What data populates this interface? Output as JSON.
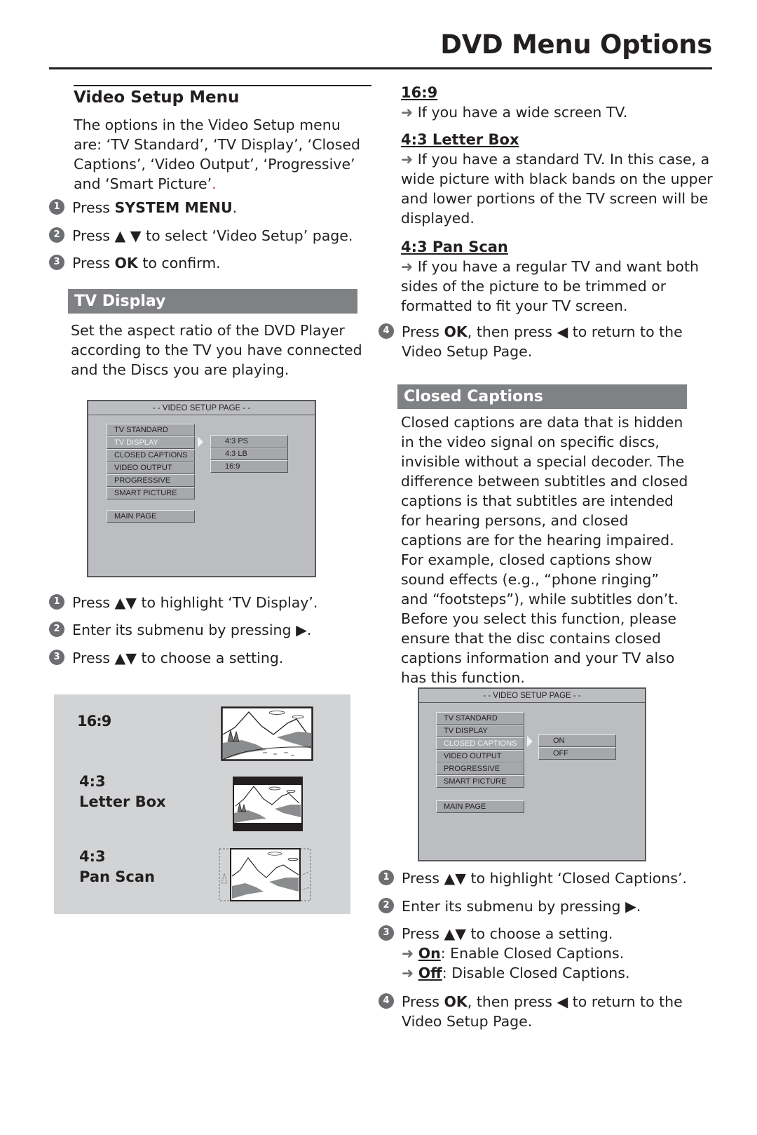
{
  "page": {
    "title": "DVD Menu Options"
  },
  "video_setup": {
    "heading": "Video Setup Menu",
    "intro": "The options in the Video Setup menu are: ‘TV Standard’, ‘TV Display’, ‘Closed Captions’, ‘Video Output’, ‘Progressive’ and ‘Smart Picture’",
    "intro_end": ".",
    "steps": [
      {
        "num": "1",
        "pre": "Press ",
        "bold": "SYSTEM MENU",
        "post": "."
      },
      {
        "num": "2",
        "pre": "Press ▲ ▼ to select ‘Video Setup’ page.",
        "bold": "",
        "post": ""
      },
      {
        "num": "3",
        "pre": "Press ",
        "bold": "OK",
        "post": " to confirm."
      }
    ]
  },
  "tv_display": {
    "heading": "TV Display",
    "description": "Set the aspect ratio of the DVD Player according to the TV you have connected and the Discs you are playing.",
    "osd": {
      "header": "- - VIDEO SETUP PAGE - -",
      "items": [
        "TV STANDARD",
        "TV DISPLAY",
        "CLOSED CAPTIONS",
        "VIDEO OUTPUT",
        "PROGRESSIVE",
        "SMART PICTURE"
      ],
      "selected_index": 1,
      "main_page": "MAIN PAGE",
      "submenu": [
        "4:3 PS",
        "4:3 LB",
        "16:9"
      ]
    },
    "steps": [
      {
        "num": "1",
        "text": "Press ▲▼ to highlight ‘TV Display’."
      },
      {
        "num": "2",
        "text": "Enter its submenu by pressing ▶."
      },
      {
        "num": "3",
        "text": "Press ▲▼ to choose a setting."
      }
    ],
    "aspect_examples": [
      {
        "line1": "16:9",
        "line2": "",
        "image": "widescreen-landscape-icon"
      },
      {
        "line1": "4:3",
        "line2": "Letter Box",
        "image": "letterbox-landscape-icon"
      },
      {
        "line1": "4:3",
        "line2": "Pan Scan",
        "image": "panscan-landscape-icon"
      }
    ],
    "options": [
      {
        "title": "16:9",
        "text": "If you have a wide screen TV."
      },
      {
        "title": "4:3 Letter Box",
        "text": "If you have a standard TV. In this case, a wide picture with black bands on the upper and lower portions of the TV screen will be displayed."
      },
      {
        "title": "4:3 Pan Scan",
        "text": "If you have a regular TV and want both sides of the picture to be trimmed or formatted to fit your TV screen."
      }
    ],
    "step4": {
      "num": "4",
      "pre": "Press ",
      "bold": "OK",
      "post": ", then press ◀ to return to the Video Setup Page."
    }
  },
  "closed_captions": {
    "heading": "Closed Captions",
    "description": "Closed captions are data that is hidden in the video signal on specific discs, invisible without a special decoder. The difference between subtitles and closed captions is that subtitles are intended for hearing persons, and closed captions are for the hearing impaired. For example, closed captions show sound effects (e.g., “phone ringing” and “footsteps”), while subtitles don’t.",
    "note": "Before you select this function, please ensure that the disc contains closed captions information and your TV also has this function.",
    "osd": {
      "header": "- - VIDEO SETUP PAGE - -",
      "items": [
        "TV STANDARD",
        "TV DISPLAY",
        "CLOSED CAPTIONS",
        "VIDEO OUTPUT",
        "PROGRESSIVE",
        "SMART PICTURE"
      ],
      "selected_index": 2,
      "main_page": "MAIN PAGE",
      "submenu": [
        "ON",
        "OFF"
      ]
    },
    "steps": [
      {
        "num": "1",
        "text": "Press ▲▼ to highlight ‘Closed Captions’."
      },
      {
        "num": "2",
        "text": "Enter its submenu by pressing ▶."
      },
      {
        "num": "3",
        "text": "Press ▲▼ to choose a setting."
      }
    ],
    "settings": [
      {
        "label": "On",
        "text": ": Enable Closed Captions."
      },
      {
        "label": "Off",
        "text": ": Disable Closed Captions."
      }
    ],
    "step4": {
      "num": "4",
      "pre": "Press ",
      "bold": "OK",
      "post": ", then press ◀ to return to the Video Setup Page."
    }
  },
  "icons": {
    "arrow": "➜"
  }
}
